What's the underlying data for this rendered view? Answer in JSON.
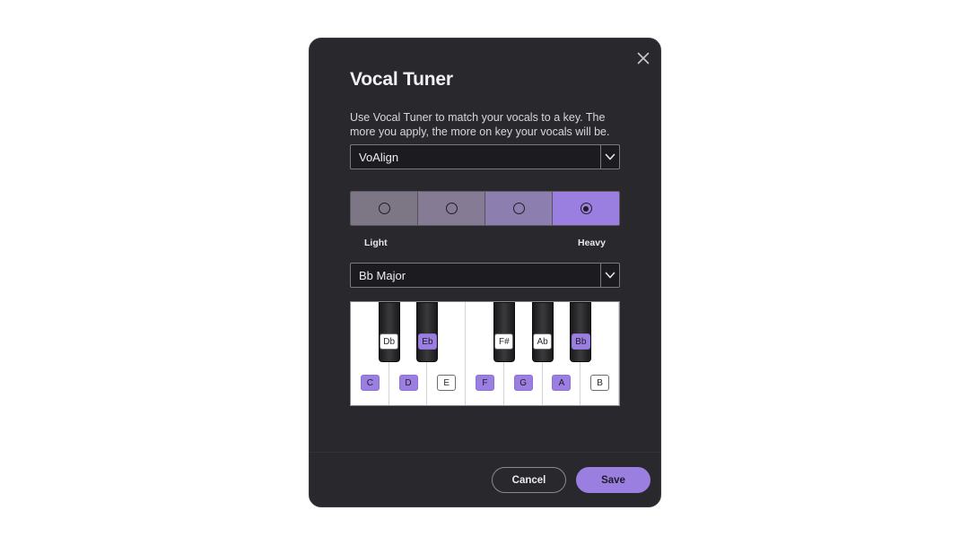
{
  "dialog": {
    "title": "Vocal Tuner",
    "description": "Use Vocal Tuner to match your vocals to a key. The more you apply, the more on key your vocals will be.",
    "close_icon": "close-icon"
  },
  "algorithm_select": {
    "value": "VoAlign",
    "icon": "chevron-down-icon"
  },
  "strength": {
    "levels": 4,
    "selected_index": 3,
    "label_min": "Light",
    "label_max": "Heavy",
    "colors": [
      "#7d7785",
      "#857b95",
      "#8c7eaf",
      "#9a7fe0"
    ]
  },
  "key_select": {
    "value": "Bb Major",
    "icon": "chevron-down-icon"
  },
  "piano": {
    "white_keys": [
      {
        "note": "C",
        "in_scale": true
      },
      {
        "note": "D",
        "in_scale": true
      },
      {
        "note": "E",
        "in_scale": false
      },
      {
        "note": "F",
        "in_scale": true
      },
      {
        "note": "G",
        "in_scale": true
      },
      {
        "note": "A",
        "in_scale": true
      },
      {
        "note": "B",
        "in_scale": false
      }
    ],
    "black_keys": [
      {
        "note": "Db",
        "in_scale": false
      },
      {
        "note": "Eb",
        "in_scale": true
      },
      {
        "note": "F#",
        "in_scale": false
      },
      {
        "note": "Ab",
        "in_scale": false
      },
      {
        "note": "Bb",
        "in_scale": true
      }
    ]
  },
  "footer": {
    "cancel_label": "Cancel",
    "save_label": "Save"
  },
  "colors": {
    "accent": "#9a7fe0",
    "dialog_bg": "#29282c"
  }
}
